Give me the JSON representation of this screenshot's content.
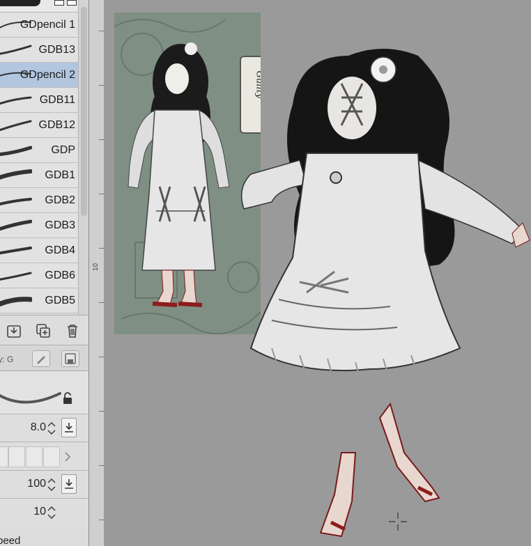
{
  "brushes": [
    {
      "name": "GDpencil 1",
      "selected": false
    },
    {
      "name": "GDB13",
      "selected": false
    },
    {
      "name": "GDpencil 2",
      "selected": true
    },
    {
      "name": "GDB11",
      "selected": false
    },
    {
      "name": "GDB12",
      "selected": false
    },
    {
      "name": "GDP",
      "selected": false
    },
    {
      "name": "GDB1",
      "selected": false
    },
    {
      "name": "GDB2",
      "selected": false
    },
    {
      "name": "GDB3",
      "selected": false
    },
    {
      "name": "GDB4",
      "selected": false
    },
    {
      "name": "GDB6",
      "selected": false
    },
    {
      "name": "GDB5",
      "selected": false
    }
  ],
  "properties": {
    "header_label": "rty: G",
    "size_value": "8.0",
    "opacity_value": "100",
    "stabilization_value": "10",
    "speed_label": "peed"
  },
  "ruler": {
    "label": "10"
  },
  "reference": {
    "label": "Guilty"
  },
  "colors": {
    "panel_bg": "#dcdcdc",
    "selected_row": "#b3c6e0",
    "canvas_bg": "#9a9a9a",
    "reference_bg": "#7f8f84",
    "blood_red": "#8c1d1d"
  }
}
